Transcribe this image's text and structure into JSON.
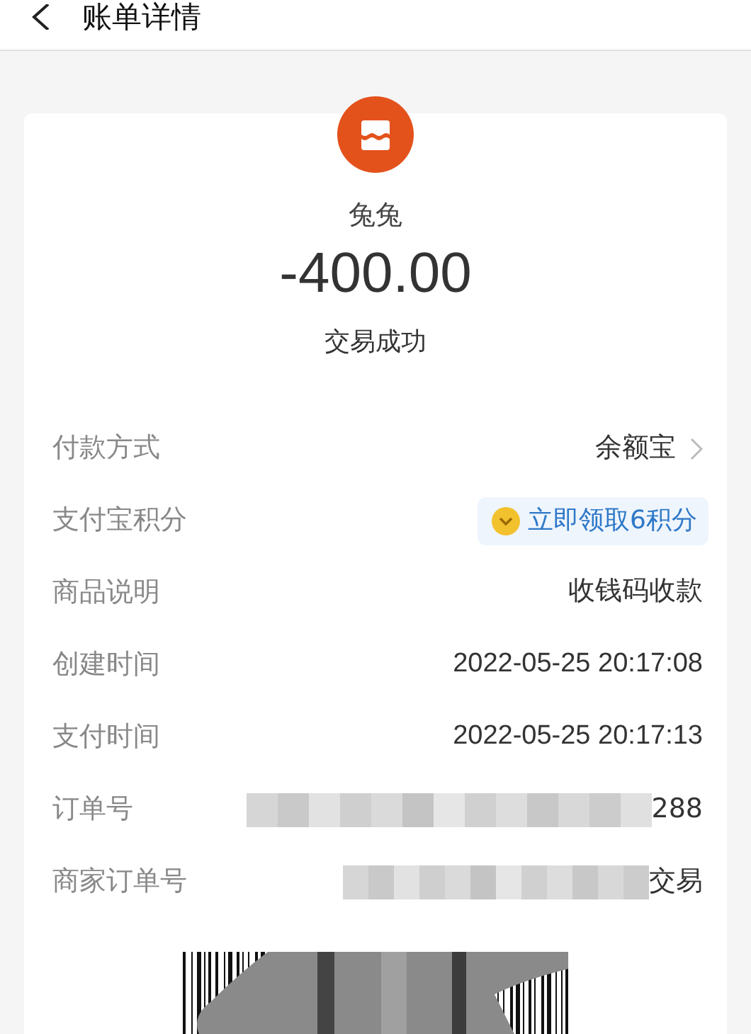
{
  "header": {
    "title": "账单详情"
  },
  "merchant": {
    "name": "兔兔",
    "amount": "-400.00",
    "status": "交易成功"
  },
  "rows": [
    {
      "kind": "link",
      "label": "付款方式",
      "value": "余额宝"
    },
    {
      "kind": "points",
      "label": "支付宝积分",
      "value": "立即领取6积分"
    },
    {
      "kind": "text",
      "label": "商品说明",
      "value": "收钱码收款"
    },
    {
      "kind": "text",
      "label": "创建时间",
      "value": "2022-05-25 20:17:08"
    },
    {
      "kind": "text",
      "label": "支付时间",
      "value": "2022-05-25 20:17:13"
    },
    {
      "kind": "masked",
      "label": "订单号",
      "value": "288"
    },
    {
      "kind": "masked",
      "label": "商家订单号",
      "value": "交易"
    }
  ]
}
